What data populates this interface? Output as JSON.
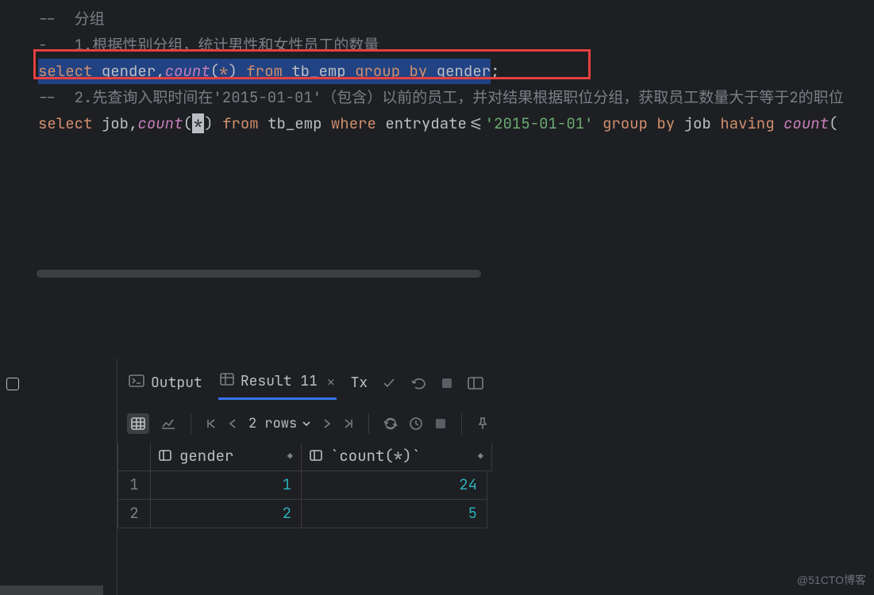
{
  "code": {
    "line1": "--  分组",
    "line2_pre": "-",
    "line2_rest": " 1.根据性别分组，统计男性和女性员工的数量",
    "line3": {
      "kw_select": "select",
      "sp1": " ",
      "id_gender": "gender",
      "comma1": ",",
      "fn_count": "count",
      "lp": "(",
      "star": "*",
      "rp": ")",
      "sp2": " ",
      "kw_from": "from",
      "sp3": " ",
      "tbl": "tb_emp",
      "sp4": " ",
      "kw_group": "group",
      "sp5": " ",
      "kw_by": "by",
      "sp6": " ",
      "id_gender2": "gender",
      "semi": ";"
    },
    "line4": "--  2.先查询入职时间在'2015-01-01'（包含）以前的员工，并对结果根据职位分组，获取员工数量大于等于2的职位",
    "line5": {
      "kw_select": "select",
      "sp1": " ",
      "id_job": "job",
      "comma1": ",",
      "fn_count": "count",
      "lp": "(",
      "star": "*",
      "rp": ")",
      "sp2": " ",
      "kw_from": "from",
      "sp3": " ",
      "tbl": "tb_emp",
      "sp4": " ",
      "kw_where": "where",
      "sp5": " ",
      "id_entry": "entrydate",
      "op": "<=",
      "str": "'2015-01-01'",
      "sp6": " ",
      "kw_group": "group",
      "sp7": " ",
      "kw_by": "by",
      "sp8": " ",
      "id_job2": "job",
      "sp9": " ",
      "kw_having": "having",
      "sp10": " ",
      "fn_count2": "count",
      "lp2": "("
    }
  },
  "tabs": {
    "output": "Output",
    "result": "Result 11",
    "tx": "Tx"
  },
  "toolbar": {
    "rows": "2 rows"
  },
  "table": {
    "header": {
      "c1": "gender",
      "c2": "`count(*)`"
    },
    "rows": [
      {
        "n": "1",
        "gender": "1",
        "count": "24"
      },
      {
        "n": "2",
        "gender": "2",
        "count": "5"
      }
    ]
  },
  "chart_data": {
    "type": "table",
    "columns": [
      "gender",
      "count(*)"
    ],
    "rows": [
      [
        1,
        24
      ],
      [
        2,
        5
      ]
    ]
  },
  "watermark": "@51CTO博客"
}
